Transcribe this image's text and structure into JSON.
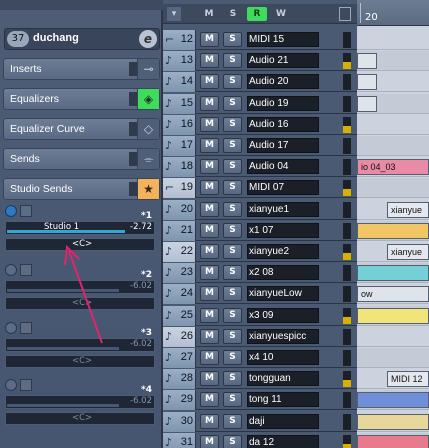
{
  "inspector": {
    "channel_number": "37",
    "channel_name": "duchang",
    "edit_icon": "e",
    "sections": [
      {
        "label": "Inserts",
        "icon": "insert-icon"
      },
      {
        "label": "Equalizers",
        "icon": "eq-icon"
      },
      {
        "label": "Equalizer Curve",
        "icon": "eq-curve-icon"
      },
      {
        "label": "Sends",
        "icon": "sends-icon"
      },
      {
        "label": "Studio Sends",
        "icon": "star-icon"
      }
    ],
    "studio_sends": [
      {
        "index": "*1",
        "destination": "Studio 1",
        "value": "-2.72",
        "pan": "<C>",
        "active": true
      },
      {
        "index": "*2",
        "destination": "",
        "value": "-6.02",
        "pan": "<C>",
        "active": false
      },
      {
        "index": "*3",
        "destination": "",
        "value": "-6.02",
        "pan": "<C>",
        "active": false
      },
      {
        "index": "*4",
        "destination": "",
        "value": "-6.02",
        "pan": "<C>",
        "active": false
      }
    ]
  },
  "track_header": {
    "buttons": [
      "M",
      "S",
      "R",
      "W"
    ]
  },
  "tracks": [
    {
      "num": "12",
      "type": "midi",
      "mute": "M",
      "solo": "S",
      "name": "MIDI 15"
    },
    {
      "num": "13",
      "type": "audio",
      "mute": "M",
      "solo": "S",
      "name": "Audio 21"
    },
    {
      "num": "14",
      "type": "audio",
      "mute": "M",
      "solo": "S",
      "name": "Audio 20"
    },
    {
      "num": "15",
      "type": "audio",
      "mute": "M",
      "solo": "S",
      "name": "Audio 19"
    },
    {
      "num": "16",
      "type": "audio",
      "mute": "M",
      "solo": "S",
      "name": "Audio 16"
    },
    {
      "num": "17",
      "type": "audio",
      "mute": "M",
      "solo": "S",
      "name": "Audio 17"
    },
    {
      "num": "18",
      "type": "audio",
      "mute": "M",
      "solo": "S",
      "name": "Audio 04"
    },
    {
      "num": "19",
      "type": "midi",
      "mute": "M",
      "solo": "S",
      "name": "MIDI 07"
    },
    {
      "num": "20",
      "type": "audio",
      "mute": "M",
      "solo": "S",
      "name": "xianyue1"
    },
    {
      "num": "21",
      "type": "audio",
      "mute": "M",
      "solo": "S",
      "name": "x1 07"
    },
    {
      "num": "22",
      "type": "audio",
      "mute": "M",
      "solo": "S",
      "name": "xianyue2"
    },
    {
      "num": "23",
      "type": "audio",
      "mute": "M",
      "solo": "S",
      "name": "x2 08"
    },
    {
      "num": "24",
      "type": "audio",
      "mute": "M",
      "solo": "S",
      "name": "xianyueLow"
    },
    {
      "num": "25",
      "type": "audio",
      "mute": "M",
      "solo": "S",
      "name": "x3 09"
    },
    {
      "num": "26",
      "type": "audio",
      "mute": "M",
      "solo": "S",
      "name": "xianyuespicc"
    },
    {
      "num": "27",
      "type": "audio",
      "mute": "M",
      "solo": "S",
      "name": "x4 10"
    },
    {
      "num": "28",
      "type": "audio",
      "mute": "M",
      "solo": "S",
      "name": "tongguan"
    },
    {
      "num": "29",
      "type": "audio",
      "mute": "M",
      "solo": "S",
      "name": "tong 11"
    },
    {
      "num": "30",
      "type": "audio",
      "mute": "M",
      "solo": "S",
      "name": "daji"
    },
    {
      "num": "31",
      "type": "audio",
      "mute": "M",
      "solo": "S",
      "name": "da 12"
    }
  ],
  "arrange": {
    "ruler_label": "20",
    "clips": [
      {
        "lane": 6,
        "text": "io 04_03",
        "color": "#e98aa6"
      },
      {
        "lane": 8,
        "text": "xianyue",
        "color": "#e4e8ee"
      },
      {
        "lane": 9,
        "text": "",
        "color": "#f1c766"
      },
      {
        "lane": 10,
        "text": "xianyue",
        "color": "#e4e8ee"
      },
      {
        "lane": 11,
        "text": "",
        "color": "#74d0d6"
      },
      {
        "lane": 12,
        "text": "ow",
        "color": "#dfe3ea"
      },
      {
        "lane": 13,
        "text": "",
        "color": "#f0e47a"
      },
      {
        "lane": 16,
        "text": "MIDI 12",
        "color": "#e4e8ee"
      },
      {
        "lane": 17,
        "text": "",
        "color": "#6f8fd8"
      },
      {
        "lane": 18,
        "text": "",
        "color": "#e8d79a"
      },
      {
        "lane": 19,
        "text": "",
        "color": "#e87a8e"
      }
    ]
  }
}
